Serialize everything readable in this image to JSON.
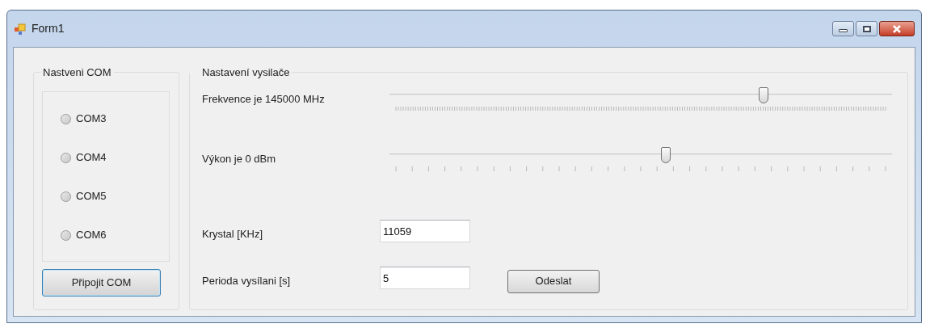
{
  "window": {
    "title": "Form1"
  },
  "com_group": {
    "title": "Nastveni COM",
    "ports": [
      {
        "label": "COM3",
        "selected": false
      },
      {
        "label": "COM4",
        "selected": false
      },
      {
        "label": "COM5",
        "selected": false
      },
      {
        "label": "COM6",
        "selected": false
      }
    ],
    "connect_button": "Připojit COM"
  },
  "transmitter_group": {
    "title": "Nastavení vysilače",
    "sliders": [
      {
        "label": "Frekvence je 145000  MHz",
        "level": 0.745,
        "kind": "dense"
      },
      {
        "label": "Výkon je 0 dBm",
        "level": 0.55,
        "kind": "sparse"
      }
    ],
    "fields": [
      {
        "label": "Krystal [KHz]",
        "value": "11059"
      },
      {
        "label": "Perioda vysílani [s]",
        "value": "5"
      }
    ],
    "send_button": "Odeslat"
  }
}
